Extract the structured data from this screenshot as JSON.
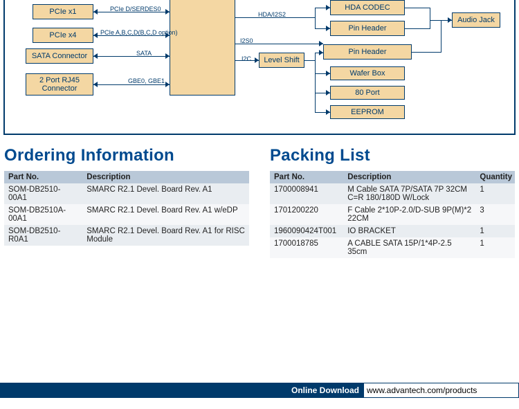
{
  "diagram": {
    "nodes": {
      "pcie_x1": "PCIe x1",
      "pcie_x4": "PCIe x4",
      "sata_conn": "SATA Connector",
      "rj45": "2 Port RJ45 Connector",
      "level_shift": "Level Shift",
      "hda_codec": "HDA CODEC",
      "pin_header1": "Pin Header",
      "pin_header2": "Pin Header",
      "wafer_box": "Wafer Box",
      "port80": "80 Port",
      "eeprom": "EEPROM",
      "audio_jack": "Audio Jack"
    },
    "labels": {
      "pcie_d": "PCIe D/SERDES0",
      "pcie_abcd": "PCIe A,B,C,D(B,C,D option)",
      "sata": "SATA",
      "gbe": "GBE0, GBE1",
      "hda_i2s2": "HDA/I2S2",
      "i2s0": "I2S0",
      "i2c": "I2C"
    }
  },
  "ordering": {
    "title": "Ordering Information",
    "headers": [
      "Part No.",
      "Description"
    ],
    "rows": [
      [
        "SOM-DB2510-00A1",
        "SMARC R2.1 Devel. Board Rev. A1"
      ],
      [
        "SOM-DB2510A-00A1",
        "SMARC R2.1 Devel. Board Rev. A1 w/eDP"
      ],
      [
        "SOM-DB2510-R0A1",
        "SMARC R2.1 Devel. Board Rev. A1 for RISC Module"
      ]
    ]
  },
  "packing": {
    "title": "Packing List",
    "headers": [
      "Part No.",
      "Description",
      "Quantity"
    ],
    "rows": [
      [
        "1700008941",
        "M Cable SATA 7P/SATA 7P 32CM C=R 180/180D W/Lock",
        "1"
      ],
      [
        "1701200220",
        "F Cable 2*10P-2.0/D-SUB 9P(M)*2 22CM",
        "3"
      ],
      [
        "1960090424T001",
        "IO BRACKET",
        "1"
      ],
      [
        "1700018785",
        "A CABLE SATA 15P/1*4P-2.5 35cm",
        "1"
      ]
    ]
  },
  "footer": {
    "label": "Online Download",
    "url": "www.advantech.com/products"
  }
}
